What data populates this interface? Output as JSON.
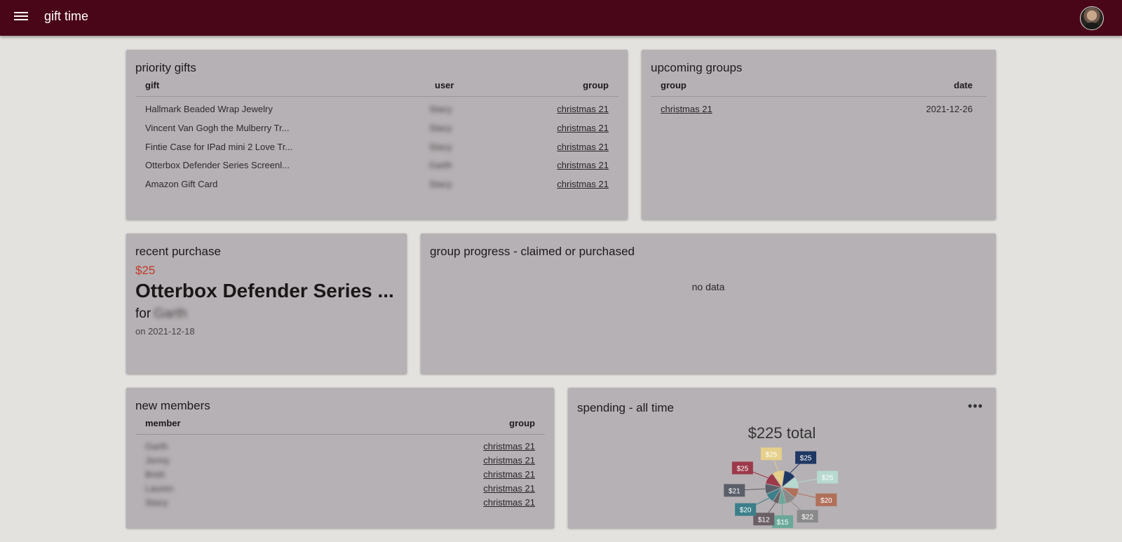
{
  "app": {
    "title": "gift time"
  },
  "priority_gifts": {
    "title": "priority gifts",
    "columns": [
      "gift",
      "user",
      "group"
    ],
    "rows": [
      {
        "gift": "Hallmark Beaded Wrap Jewelry",
        "user": "Stacy",
        "group": "christmas 21"
      },
      {
        "gift": "Vincent Van Gogh the Mulberry Tr...",
        "user": "Stacy",
        "group": "christmas 21"
      },
      {
        "gift": "Fintie Case for IPad mini 2 Love Tr...",
        "user": "Stacy",
        "group": "christmas 21"
      },
      {
        "gift": "Otterbox Defender Series Screenl...",
        "user": "Garth",
        "group": "christmas 21"
      },
      {
        "gift": "Amazon Gift Card",
        "user": "Stacy",
        "group": "christmas 21"
      }
    ]
  },
  "upcoming_groups": {
    "title": "upcoming groups",
    "columns": [
      "group",
      "date"
    ],
    "rows": [
      {
        "group": "christmas 21",
        "date": "2021-12-26"
      }
    ]
  },
  "recent_purchase": {
    "title": "recent purchase",
    "price": "$25",
    "name": "Otterbox Defender Series ...",
    "for_label": "for",
    "for_user": "Garth",
    "date": "on 2021-12-18"
  },
  "group_progress": {
    "title": "group progress - claimed or purchased",
    "empty": "no data"
  },
  "new_members": {
    "title": "new members",
    "columns": [
      "member",
      "group"
    ],
    "rows": [
      {
        "member": "Garth",
        "group": "christmas 21"
      },
      {
        "member": "Jenny",
        "group": "christmas 21"
      },
      {
        "member": "Brett",
        "group": "christmas 21"
      },
      {
        "member": "Lauren",
        "group": "christmas 21"
      },
      {
        "member": "Stacy",
        "group": "christmas 21"
      }
    ]
  },
  "spending": {
    "title": "spending - all time",
    "more_icon": "more-horizontal-icon",
    "total_label": "$225 total"
  },
  "chart_data": {
    "type": "pie",
    "title": "$225 total",
    "values": [
      25,
      25,
      20,
      22,
      15,
      12,
      20,
      21,
      25,
      25
    ],
    "labels": [
      "$25",
      "$25",
      "$20",
      "$22",
      "$15",
      "$12",
      "$20",
      "$21",
      "$25",
      "$25"
    ],
    "colors": [
      "#1f3864",
      "#b7d9cf",
      "#b0705a",
      "#8a8a8a",
      "#6aa99a",
      "#6b5f66",
      "#3c7f8a",
      "#5a5e68",
      "#9c3a4b",
      "#e6d08a"
    ]
  }
}
